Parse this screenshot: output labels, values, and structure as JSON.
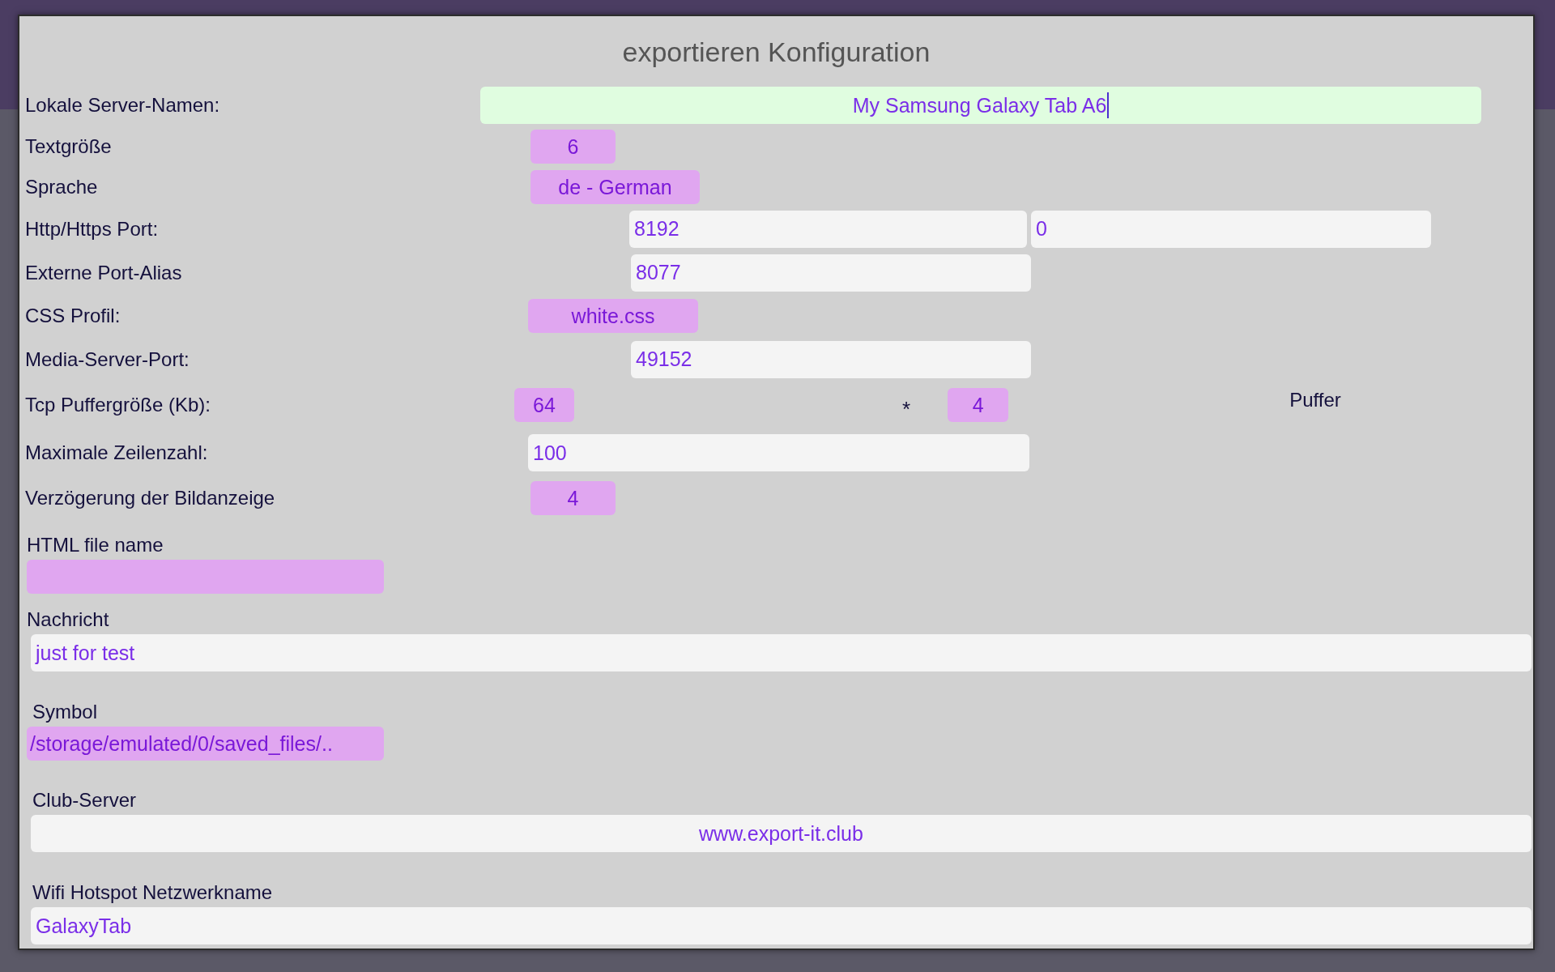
{
  "dialog": {
    "title": "exportieren Konfiguration"
  },
  "rows": [
    {
      "kind": "text-field",
      "label": "Lokale Server-Namen:",
      "value": "My Samsung Galaxy Tab A6",
      "focused": true,
      "centered": true
    },
    {
      "kind": "spinner",
      "label": "Textgröße",
      "value": "6"
    },
    {
      "kind": "spinner",
      "label": "Sprache",
      "value": "de - German"
    },
    {
      "kind": "dual-field",
      "label": "Http/Https Port:",
      "values": [
        "8192",
        "0"
      ]
    },
    {
      "kind": "text-field",
      "label": "Externe Port-Alias",
      "value": "8077",
      "focused": false,
      "centered": false
    },
    {
      "kind": "spinner",
      "label": "CSS Profil:",
      "value": "white.css"
    },
    {
      "kind": "text-field",
      "label": "Media-Server-Port:",
      "value": "49152",
      "focused": false,
      "centered": false
    },
    {
      "kind": "buffer",
      "label": "Tcp Puffergröße (Kb):",
      "value": "64",
      "operator": "*",
      "count": "4",
      "unit": "Puffer"
    },
    {
      "kind": "text-field",
      "label": "Maximale Zeilenzahl:",
      "value": "100",
      "focused": false,
      "centered": false
    },
    {
      "kind": "spinner",
      "label": "Verzögerung der Bildanzeige",
      "value": "4"
    }
  ],
  "sections": [
    {
      "kind": "spinner",
      "label": "HTML file name"
    },
    {
      "kind": "text-field",
      "label": "Nachricht",
      "value": "just for test",
      "focused": false,
      "centered": false
    },
    {
      "kind": "spinner",
      "label": "Symbol",
      "value": "/storage/emulated/0/saved_files/.."
    },
    {
      "kind": "text-field",
      "label": "Club-Server",
      "value": "www.export-it.club",
      "focused": false,
      "centered": true
    },
    {
      "kind": "text-field",
      "label": "Wifi Hotspot Netzwerkname",
      "value": "GalaxyTab",
      "focused": false,
      "centered": false
    }
  ]
}
